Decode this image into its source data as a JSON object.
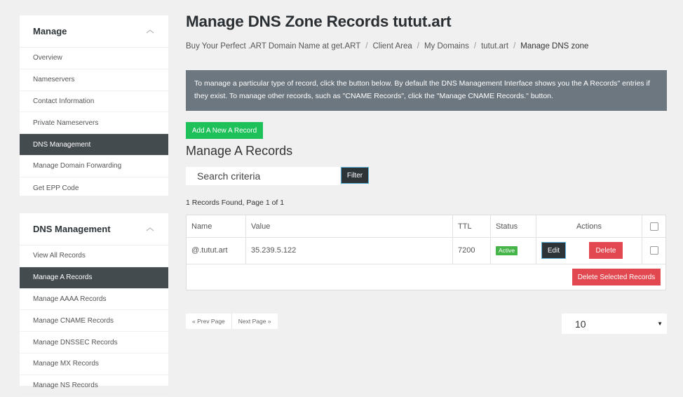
{
  "sidebar": {
    "manage": {
      "title": "Manage",
      "items": [
        "Overview",
        "Nameservers",
        "Contact Information",
        "Private Nameservers",
        "DNS Management",
        "Manage Domain Forwarding",
        "Get EPP Code"
      ],
      "active_index": 4
    },
    "dns": {
      "title": "DNS Management",
      "items": [
        "View All Records",
        "Manage A Records",
        "Manage AAAA Records",
        "Manage CNAME Records",
        "Manage DNSSEC Records",
        "Manage MX Records",
        "Manage NS Records"
      ],
      "active_index": 1
    }
  },
  "page": {
    "title": "Manage DNS Zone Records tutut.art",
    "breadcrumb": [
      "Buy Your Perfect .ART Domain Name at get.ART",
      "Client Area",
      "My Domains",
      "tutut.art",
      "Manage DNS zone"
    ],
    "info": "To manage a particular type of record, click the button below. By default the DNS Management Interface shows you the  A Records\" entries if they exist. To manage other records, such as \"CNAME Records\", click the \"Manage CNAME Records.\" button.",
    "add_button": "Add A New A Record",
    "section_title": "Manage A Records",
    "search_placeholder": "Search criteria",
    "filter_button": "Filter",
    "records_found": "1 Records Found, Page 1 of 1"
  },
  "table": {
    "headers": {
      "name": "Name",
      "value": "Value",
      "ttl": "TTL",
      "status": "Status",
      "actions": "Actions"
    },
    "rows": [
      {
        "name": "@.tutut.art",
        "value": "35.239.5.122",
        "ttl": "7200",
        "status": "Active",
        "edit": "Edit",
        "delete": "Delete"
      }
    ],
    "delete_selected": "Delete Selected Records"
  },
  "pagination": {
    "prev": "« Prev Page",
    "next": "Next Page »"
  },
  "per_page": {
    "value": "10"
  },
  "colors": {
    "sidebar_active": "#444b4f",
    "add_button": "#1ec05a",
    "delete": "#e24850",
    "info_bg": "#6d7780",
    "status_active": "#45b449"
  },
  "icons": {
    "panel_collapse": "chevron-up-icon",
    "select": "caret-down-icon"
  }
}
